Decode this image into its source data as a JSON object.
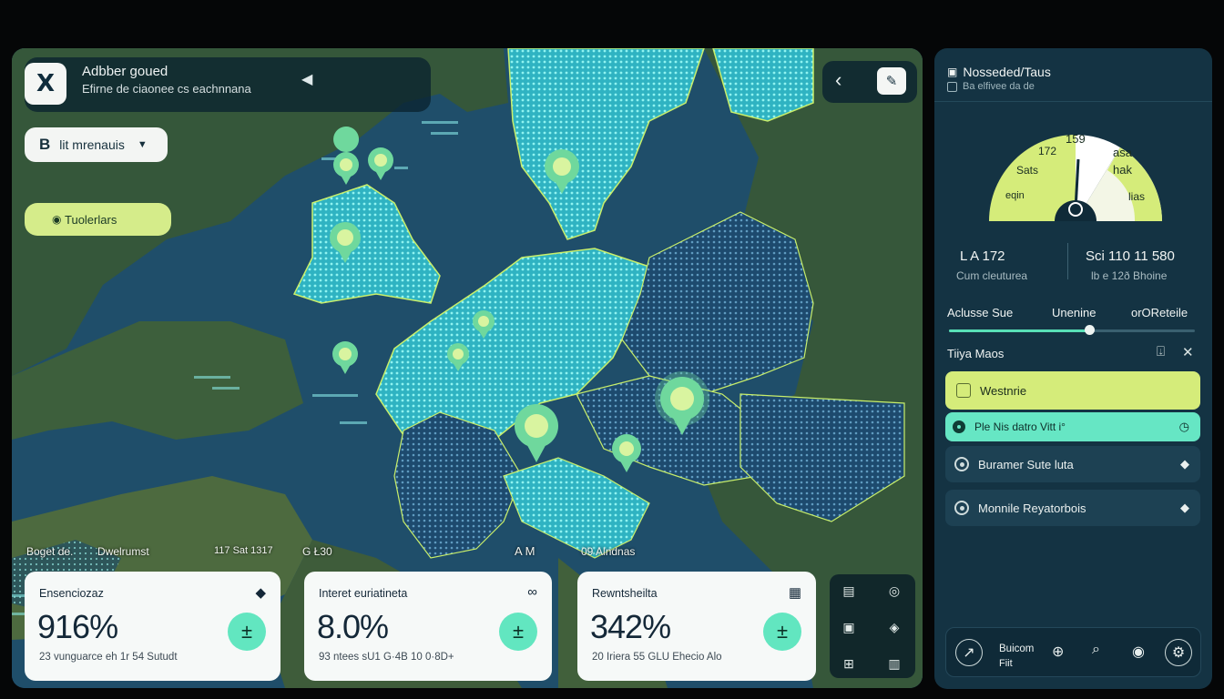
{
  "header": {
    "close_label": "X",
    "title": "Adbber goued",
    "subtitle": "Efirne de ciaonee cs eachnnana"
  },
  "controls": {
    "layer_select_label": "lit mrenauis",
    "layer_select_icon": "B",
    "tool_pill_label": "Tuolerlars"
  },
  "map_labels": {
    "bottom_left_1": "Boget de.",
    "bottom_left_2": "Dwelrumst",
    "bottom_mid": "117  Sat 1317",
    "bottom_code": "G Ł30",
    "bottom_am": "A  M",
    "bottom_right": "09 Alndnas"
  },
  "stat_cards": [
    {
      "title": "Ensenciozaz",
      "value": "916%",
      "sub": "23 vunguarce eh 1r 54 Sutudt"
    },
    {
      "title": "Interet euriatineta",
      "value": "8.0%",
      "sub": "93 ntees sU1 G·4B 10 0·8D+"
    },
    {
      "title": "Rewntsheilta",
      "value": "342%",
      "sub": "20 Iriera 55 GLU Ehecio Alo"
    }
  ],
  "side_panel": {
    "title": "Nosseded/Taus",
    "subtitle": "Ba elfivee da de",
    "gauge": {
      "labels": {
        "top_left": "172",
        "top": "159",
        "left": "Sats",
        "right_top": "asa",
        "right": "hak",
        "bottom_left": "eqin",
        "bottom_right": "lias"
      }
    },
    "metrics": {
      "left_value": "L A 172",
      "left_sub": "Cum cleuturea",
      "right_value": "Sci 110  11 580",
      "right_sub": "lb e 12ð Bhoine"
    },
    "legend": {
      "a": "Aclusse Sue",
      "b": "Unenine",
      "c": "orOReteile",
      "slider_value": 0.57
    },
    "list": {
      "header": "Tiiya Maos",
      "items": [
        "Westnrie",
        "Ple Nis datro Vitt i°",
        "Buramer Sute luta",
        "Monnile Reyatorbois"
      ]
    },
    "bottom": {
      "label1": "Buicom",
      "label2": "Fiit"
    }
  },
  "colors": {
    "accent_lime": "#d5ec7a",
    "accent_teal": "#62e6c0",
    "panel_bg": "#143343"
  }
}
